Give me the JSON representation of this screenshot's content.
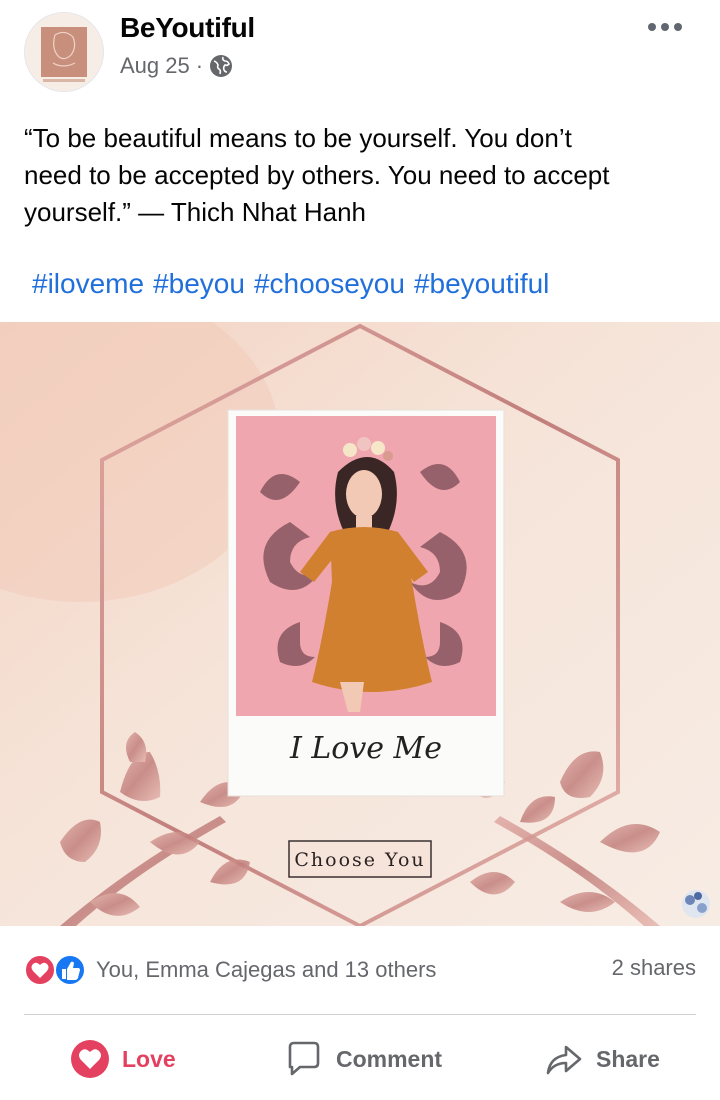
{
  "post": {
    "page_name": "BeYoutiful",
    "date": "Aug 25",
    "separator": "·",
    "privacy_icon": "globe-icon",
    "more_icon": "more-options-icon",
    "text_lines": [
      "“To be beautiful means to be yourself. You don’t",
      "need to be accepted by others. You need to accept",
      "yourself.” — Thich Nhat Hanh"
    ],
    "hashtags": [
      "#iloveme",
      "#beyou",
      "#chooseyou",
      "#beyoutiful"
    ]
  },
  "image": {
    "script_text": "I Love Me",
    "button_text": "Choose You"
  },
  "reactions": {
    "summary": "You, Emma Cajegas and 13 others",
    "shares": "2 shares",
    "icons": [
      "love-reaction-icon",
      "like-reaction-icon"
    ]
  },
  "actions": [
    {
      "label": "Love",
      "icon": "heart-icon",
      "active": true
    },
    {
      "label": "Comment",
      "icon": "comment-icon",
      "active": false
    },
    {
      "label": "Share",
      "icon": "share-icon",
      "active": false
    }
  ],
  "colors": {
    "link": "#216fdb",
    "love": "#e4405f",
    "like": "#1877f2",
    "muted": "#65676b",
    "photo_bg": "#f5e8df",
    "polaroid_pink": "#f0a6ae",
    "rose_gold": "#c98a86"
  }
}
